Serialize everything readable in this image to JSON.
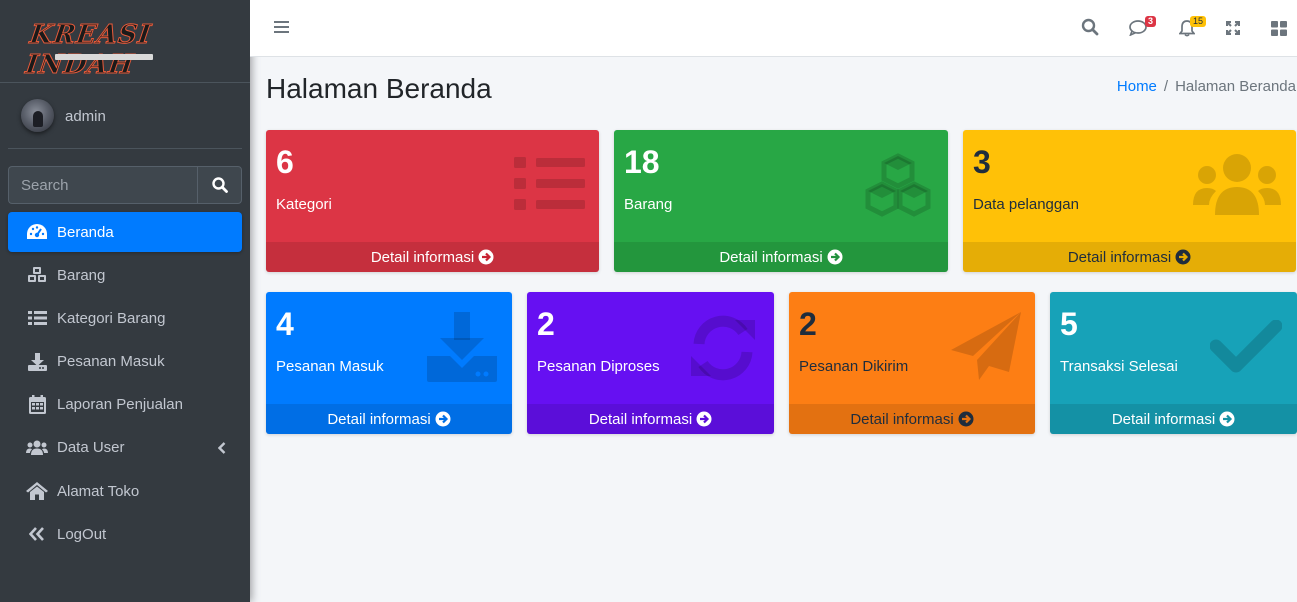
{
  "brand": {
    "logo_text": "KREASI INDAH"
  },
  "user": {
    "name": "admin"
  },
  "search": {
    "placeholder": "Search"
  },
  "sidebar": {
    "items": [
      {
        "label": "Beranda",
        "icon": "tachometer-icon",
        "active": true
      },
      {
        "label": "Barang",
        "icon": "cubes-icon"
      },
      {
        "label": "Kategori Barang",
        "icon": "list-icon"
      },
      {
        "label": "Pesanan Masuk",
        "icon": "download-icon"
      },
      {
        "label": "Laporan Penjualan",
        "icon": "calendar-icon"
      },
      {
        "label": "Data User",
        "icon": "users-icon",
        "has_submenu": true
      },
      {
        "label": "Alamat Toko",
        "icon": "home-icon"
      },
      {
        "label": "LogOut",
        "icon": "double-left-icon"
      }
    ]
  },
  "topbar": {
    "messages_badge": "3",
    "notifications_badge": "15"
  },
  "page": {
    "title": "Halaman Beranda",
    "breadcrumb": {
      "home": "Home",
      "current": "Halaman Beranda"
    }
  },
  "boxes": [
    {
      "value": "6",
      "label": "Kategori",
      "footer": "Detail informasi",
      "color": "#dc3545",
      "icon": "list-icon"
    },
    {
      "value": "18",
      "label": "Barang",
      "footer": "Detail informasi",
      "color": "#28a745",
      "icon": "cubes-icon"
    },
    {
      "value": "3",
      "label": "Data pelanggan",
      "footer": "Detail informasi",
      "color": "#ffc107",
      "icon": "users-icon"
    },
    {
      "value": "4",
      "label": "Pesanan Masuk",
      "footer": "Detail informasi",
      "color": "#007bff",
      "icon": "download-icon"
    },
    {
      "value": "2",
      "label": "Pesanan Diproses",
      "footer": "Detail informasi",
      "color": "#6610f2",
      "icon": "sync-icon"
    },
    {
      "value": "2",
      "label": "Pesanan Dikirim",
      "footer": "Detail informasi",
      "color": "#fd7e14",
      "icon": "paper-plane-icon"
    },
    {
      "value": "5",
      "label": "Transaksi Selesai",
      "footer": "Detail informasi",
      "color": "#17a2b8",
      "icon": "check-icon"
    }
  ]
}
